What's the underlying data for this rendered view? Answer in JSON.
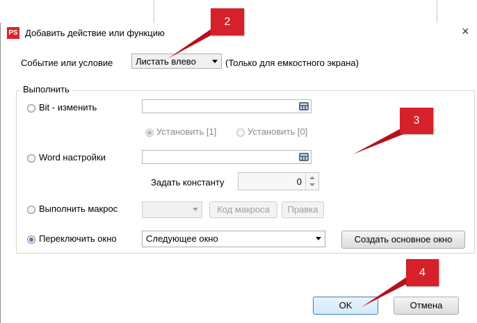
{
  "dialog": {
    "app_icon": "PS",
    "title": "Добавить действие или функцию",
    "close": "×"
  },
  "event": {
    "label": "Событие или условие",
    "selected": "Листать влево",
    "note": "(Только для емкостного экрана)"
  },
  "execute_group": {
    "legend": "Выполнить",
    "bit": {
      "label": "Bit - изменить",
      "options": [
        "Установить [1]",
        "Установить [0]"
      ]
    },
    "word": {
      "label": "Word настройки",
      "constant_label": "Задать константу",
      "constant_value": "0"
    },
    "macro": {
      "label": "Выполнить макрос",
      "code_button": "Код макроса",
      "edit_button": "Правка"
    },
    "switch_window": {
      "label": "Переключить окно",
      "selected": "Следующее окно",
      "create_button": "Создать основное окно"
    }
  },
  "footer": {
    "ok": "OK",
    "cancel": "Отмена"
  },
  "annotations": [
    "2",
    "3",
    "4"
  ],
  "colors": {
    "badge": "#d6202a",
    "accent": "#3b7fd1"
  }
}
